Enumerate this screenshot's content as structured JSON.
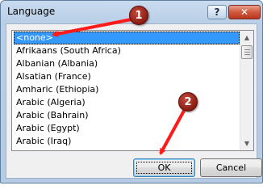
{
  "window": {
    "title": "Language",
    "help_button": "?",
    "close_button": "✕"
  },
  "language_list": {
    "selected_index": 0,
    "items": [
      "<none>",
      "Afrikaans (South Africa)",
      "Albanian (Albania)",
      "Alsatian (France)",
      "Amharic (Ethiopia)",
      "Arabic (Algeria)",
      "Arabic (Bahrain)",
      "Arabic (Egypt)",
      "Arabic (Iraq)"
    ]
  },
  "buttons": {
    "ok": "OK",
    "cancel": "Cancel"
  },
  "annotations": {
    "step_1": "1",
    "step_2": "2",
    "marker_color": "#9e2a1f",
    "arrow_color": "#ff1a1a"
  },
  "colors": {
    "selection": "#3399ff",
    "title_bar": "#c9dbef",
    "close_button": "#cf5a3e"
  }
}
